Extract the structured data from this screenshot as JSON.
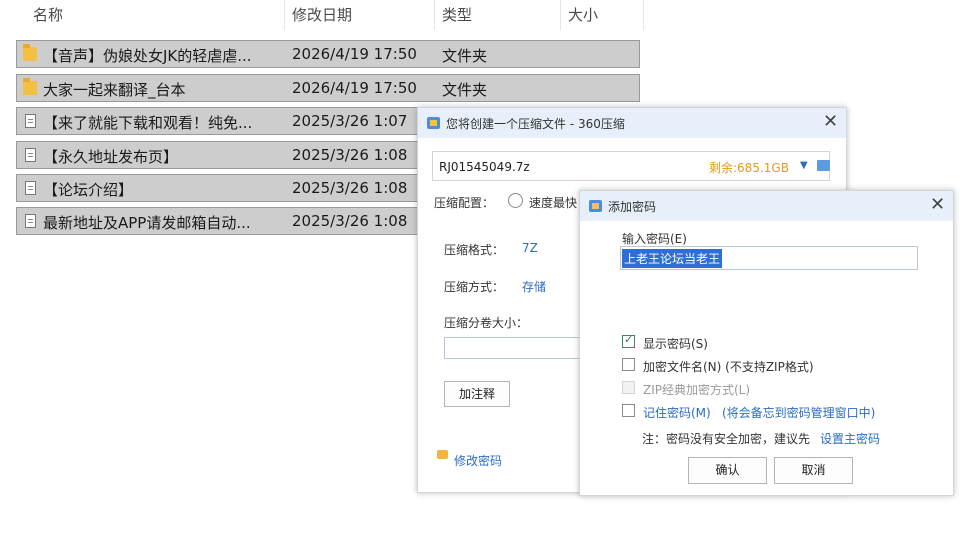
{
  "explorer": {
    "columns": {
      "name": "名称",
      "modified": "修改日期",
      "type": "类型",
      "size": "大小"
    },
    "rows": [
      {
        "name": "【音声】伪娘处女JK的轻虐虐...",
        "date": "2026/4/19 17:50",
        "type": "文件夹",
        "icon": "folder-icon"
      },
      {
        "name": "大家一起来翻译_台本",
        "date": "2026/4/19 17:50",
        "type": "文件夹",
        "icon": "folder-icon"
      },
      {
        "name": "【来了就能下载和观看！纯免...",
        "date": "2025/3/26 1:07",
        "type": "",
        "icon": "file-icon"
      },
      {
        "name": "【永久地址发布页】",
        "date": "2025/3/26 1:08",
        "type": "",
        "icon": "file-icon"
      },
      {
        "name": "【论坛介绍】",
        "date": "2025/3/26 1:08",
        "type": "",
        "icon": "file-icon"
      },
      {
        "name": "最新地址及APP请发邮箱自动...",
        "date": "2025/3/26 1:08",
        "type": "",
        "icon": "file-icon"
      }
    ]
  },
  "compress_dialog": {
    "title": "您将创建一个压缩文件 - 360压缩",
    "filename": "RJ01545049.7z",
    "free_space": "剩余:685.1GB",
    "config_label": "压缩配置：",
    "config_option": "速度最快",
    "format_label": "压缩格式：",
    "format_value": "7Z",
    "method_label": "压缩方式：",
    "method_value": "存储",
    "split_label": "压缩分卷大小：",
    "comment_button": "加注释",
    "change_password": "修改密码",
    "accent": "#2b6cc4",
    "space_color": "#e39a1c"
  },
  "password_dialog": {
    "title": "添加密码",
    "input_label": "输入密码(E)",
    "password_value": "上老王论坛当老王",
    "show_password": "显示密码(S)",
    "encrypt_names": "加密文件名(N) (不支持ZIP格式)",
    "zip_classic": "ZIP经典加密方式(L)",
    "remember_password": "记住密码(M)",
    "remember_note": "(将会备忘到密码管理窗口中)",
    "note_text": "注：密码没有安全加密，建议先",
    "note_link": "设置主密码",
    "ok_button": "确认",
    "cancel_button": "取消"
  }
}
